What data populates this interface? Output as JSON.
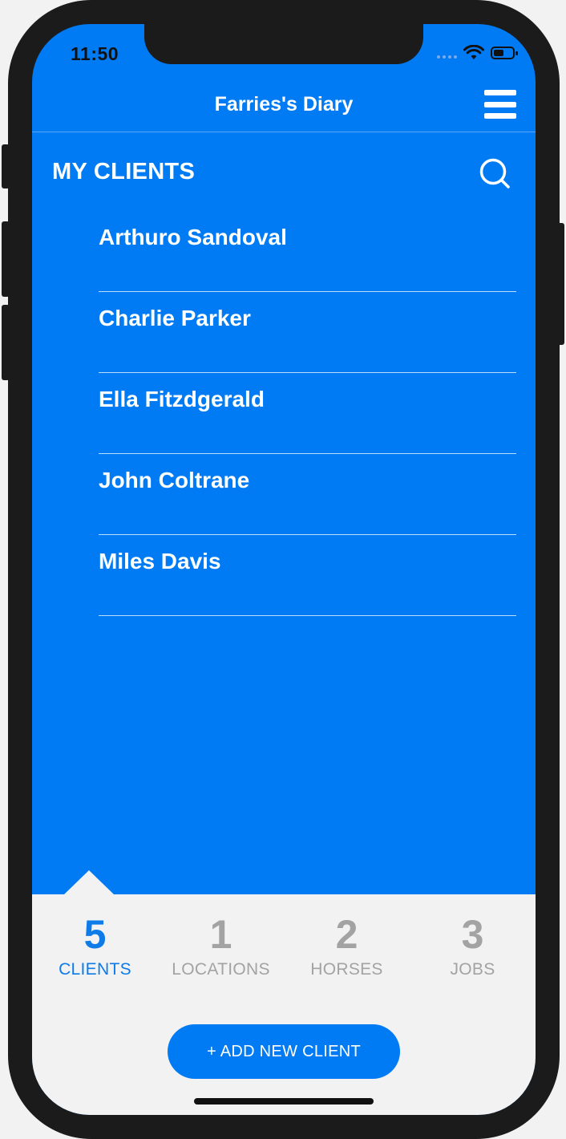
{
  "status": {
    "time": "11:50"
  },
  "navbar": {
    "title": "Farries's Diary"
  },
  "section": {
    "title": "MY CLIENTS"
  },
  "clients": [
    {
      "name": "Arthuro Sandoval"
    },
    {
      "name": "Charlie Parker"
    },
    {
      "name": "Ella Fitzdgerald"
    },
    {
      "name": "John Coltrane"
    },
    {
      "name": "Miles Davis"
    }
  ],
  "tabs": [
    {
      "count": "5",
      "label": "CLIENTS",
      "active": true
    },
    {
      "count": "1",
      "label": "LOCATIONS",
      "active": false
    },
    {
      "count": "2",
      "label": "HORSES",
      "active": false
    },
    {
      "count": "3",
      "label": "JOBS",
      "active": false
    }
  ],
  "add_button": {
    "label": "+ ADD NEW CLIENT"
  },
  "colors": {
    "accent": "#007bf4",
    "active_tab": "#0d7be8",
    "inactive_tab": "#a3a3a3",
    "tabbar_bg": "#f2f2f2"
  },
  "icons": {
    "menu": "hamburger-icon",
    "search": "search-icon",
    "wifi": "wifi-icon",
    "battery": "battery-icon"
  }
}
